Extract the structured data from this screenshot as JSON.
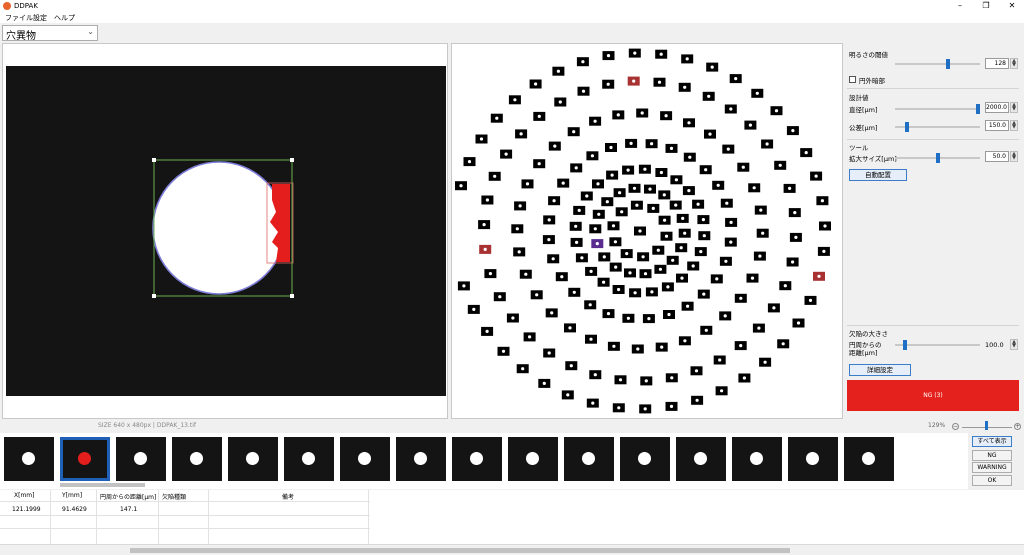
{
  "window": {
    "title": "DDPAK",
    "minimize": "–",
    "maximize": "❐",
    "close": "✕"
  },
  "menu": [
    "ファイル",
    "設定",
    "ヘルプ"
  ],
  "mode_select": {
    "value": "穴異物",
    "options": [
      "穴異物"
    ]
  },
  "settings": {
    "brightness": {
      "title": "明るさの閾値",
      "value": "128",
      "level": 0.6
    },
    "ring_dark": {
      "label": "円外暗部",
      "checked": false
    },
    "design": {
      "title": "設計値",
      "diameter": {
        "label": "直径[μm]",
        "value": "2000.0",
        "level": 1.0
      },
      "tolerance": {
        "label": "公差[μm]",
        "value": "150.0",
        "level": 0.12
      }
    },
    "tool": {
      "title": "ツール",
      "magnify": {
        "label": "拡大サイズ[μm]",
        "value": "50.0",
        "level": 0.5
      },
      "auto_layout_button": "自動配置"
    },
    "defect": {
      "title": "欠陥の大きさ",
      "distance": {
        "label_line1": "円周からの",
        "label_line2": "距離[μm]",
        "value": "100.0",
        "level": 0.1
      },
      "detail_button": "詳細設定"
    },
    "result": {
      "label": "NG (3)",
      "color": "#e4211c"
    }
  },
  "image_view": {
    "size_info": "SIZE 640 x 480px | DDPAK_13.tif"
  },
  "zoom": {
    "percent": "129%",
    "minus": "−",
    "plus": "+",
    "level": 0.5
  },
  "hole_map": {
    "markers_ng": 3,
    "ng_color": "#a83232",
    "selected_color": "#5a2c90",
    "rings": 7
  },
  "thumbnails": {
    "count": 16,
    "selected_index": 1
  },
  "filters": [
    "すべて表示",
    "NG",
    "WARNING",
    "OK"
  ],
  "table": {
    "columns": [
      "X[mm]",
      "Y[mm]",
      "円周からの距離[μm]",
      "欠陥種類",
      "備考"
    ],
    "rows": [
      [
        "121.1999",
        "91.4629",
        "147.1",
        "",
        ""
      ]
    ]
  }
}
